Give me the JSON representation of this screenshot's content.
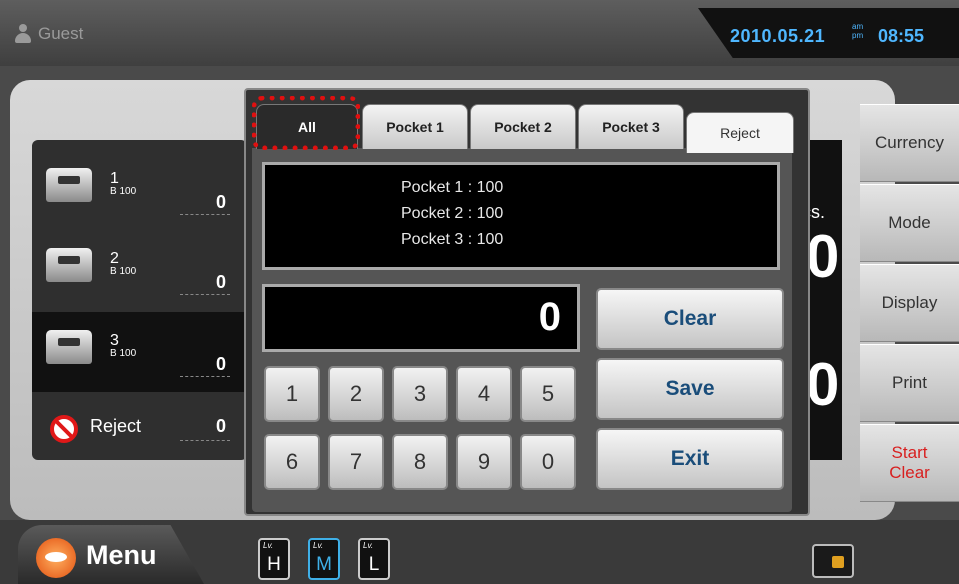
{
  "header": {
    "user": "Guest",
    "date": "2010.05.21",
    "am": "am",
    "pm": "pm",
    "time": "08:55"
  },
  "pockets": [
    {
      "number": "1",
      "denomination": "B 100",
      "count": "0"
    },
    {
      "number": "2",
      "denomination": "B 100",
      "count": "0"
    },
    {
      "number": "3",
      "denomination": "B 100",
      "count": "0"
    }
  ],
  "reject": {
    "label": "Reject",
    "count": "0"
  },
  "right_panel": {
    "pcs_fragment": "cs.",
    "digit_top": "0",
    "digit_bottom": "0"
  },
  "side_menu": [
    "Currency",
    "Mode",
    "Display",
    "Print"
  ],
  "start_clear": {
    "line1": "Start",
    "line2": "Clear"
  },
  "bottom": {
    "menu_label": "Menu",
    "levels": [
      {
        "tag": "Lv.",
        "value": "H"
      },
      {
        "tag": "Lv.",
        "value": "M"
      },
      {
        "tag": "Lv.",
        "value": "L"
      }
    ]
  },
  "dialog": {
    "tabs": [
      "All",
      "Pocket 1",
      "Pocket 2",
      "Pocket 3",
      "Reject"
    ],
    "active_tab": "All",
    "info_lines": [
      "Pocket 1 : 100",
      "Pocket 2 : 100",
      "Pocket 3 : 100"
    ],
    "display_value": "0",
    "keys": [
      "1",
      "2",
      "3",
      "4",
      "5",
      "6",
      "7",
      "8",
      "9",
      "0"
    ],
    "actions": [
      "Clear",
      "Save",
      "Exit"
    ]
  }
}
